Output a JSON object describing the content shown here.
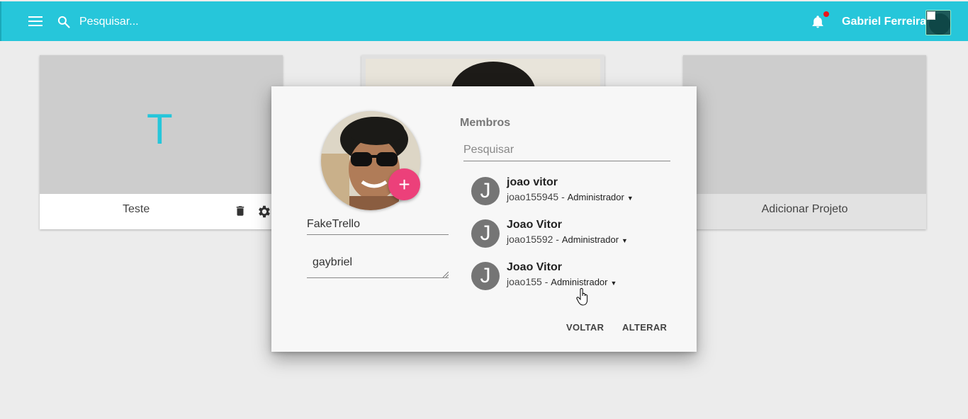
{
  "topbar": {
    "search_placeholder": "Pesquisar...",
    "username": "Gabriel Ferreira",
    "has_notification": true,
    "colors": {
      "bar": "#26c6da",
      "notification_dot": "#e8141b"
    }
  },
  "projects": [
    {
      "initial": "T",
      "title": "Teste"
    },
    {
      "title": ""
    },
    {
      "title": "Adicionar Projeto"
    }
  ],
  "modal": {
    "project_name": "FakeTrello",
    "description": "gaybriel",
    "add_photo_label": "+",
    "members_title": "Membros",
    "members_search_placeholder": "Pesquisar",
    "members": [
      {
        "initial": "J",
        "name": "joao vitor",
        "login": "joao155945 -",
        "role": "Administrador"
      },
      {
        "initial": "J",
        "name": "Joao Vitor",
        "login": "joao15592 -",
        "role": "Administrador"
      },
      {
        "initial": "J",
        "name": "Joao Vitor",
        "login": "joao155 -",
        "role": "Administrador"
      }
    ],
    "buttons": {
      "back": "VOLTAR",
      "save": "ALTERAR"
    },
    "colors": {
      "fab": "#ec407a",
      "member_avatar": "#757575"
    }
  }
}
